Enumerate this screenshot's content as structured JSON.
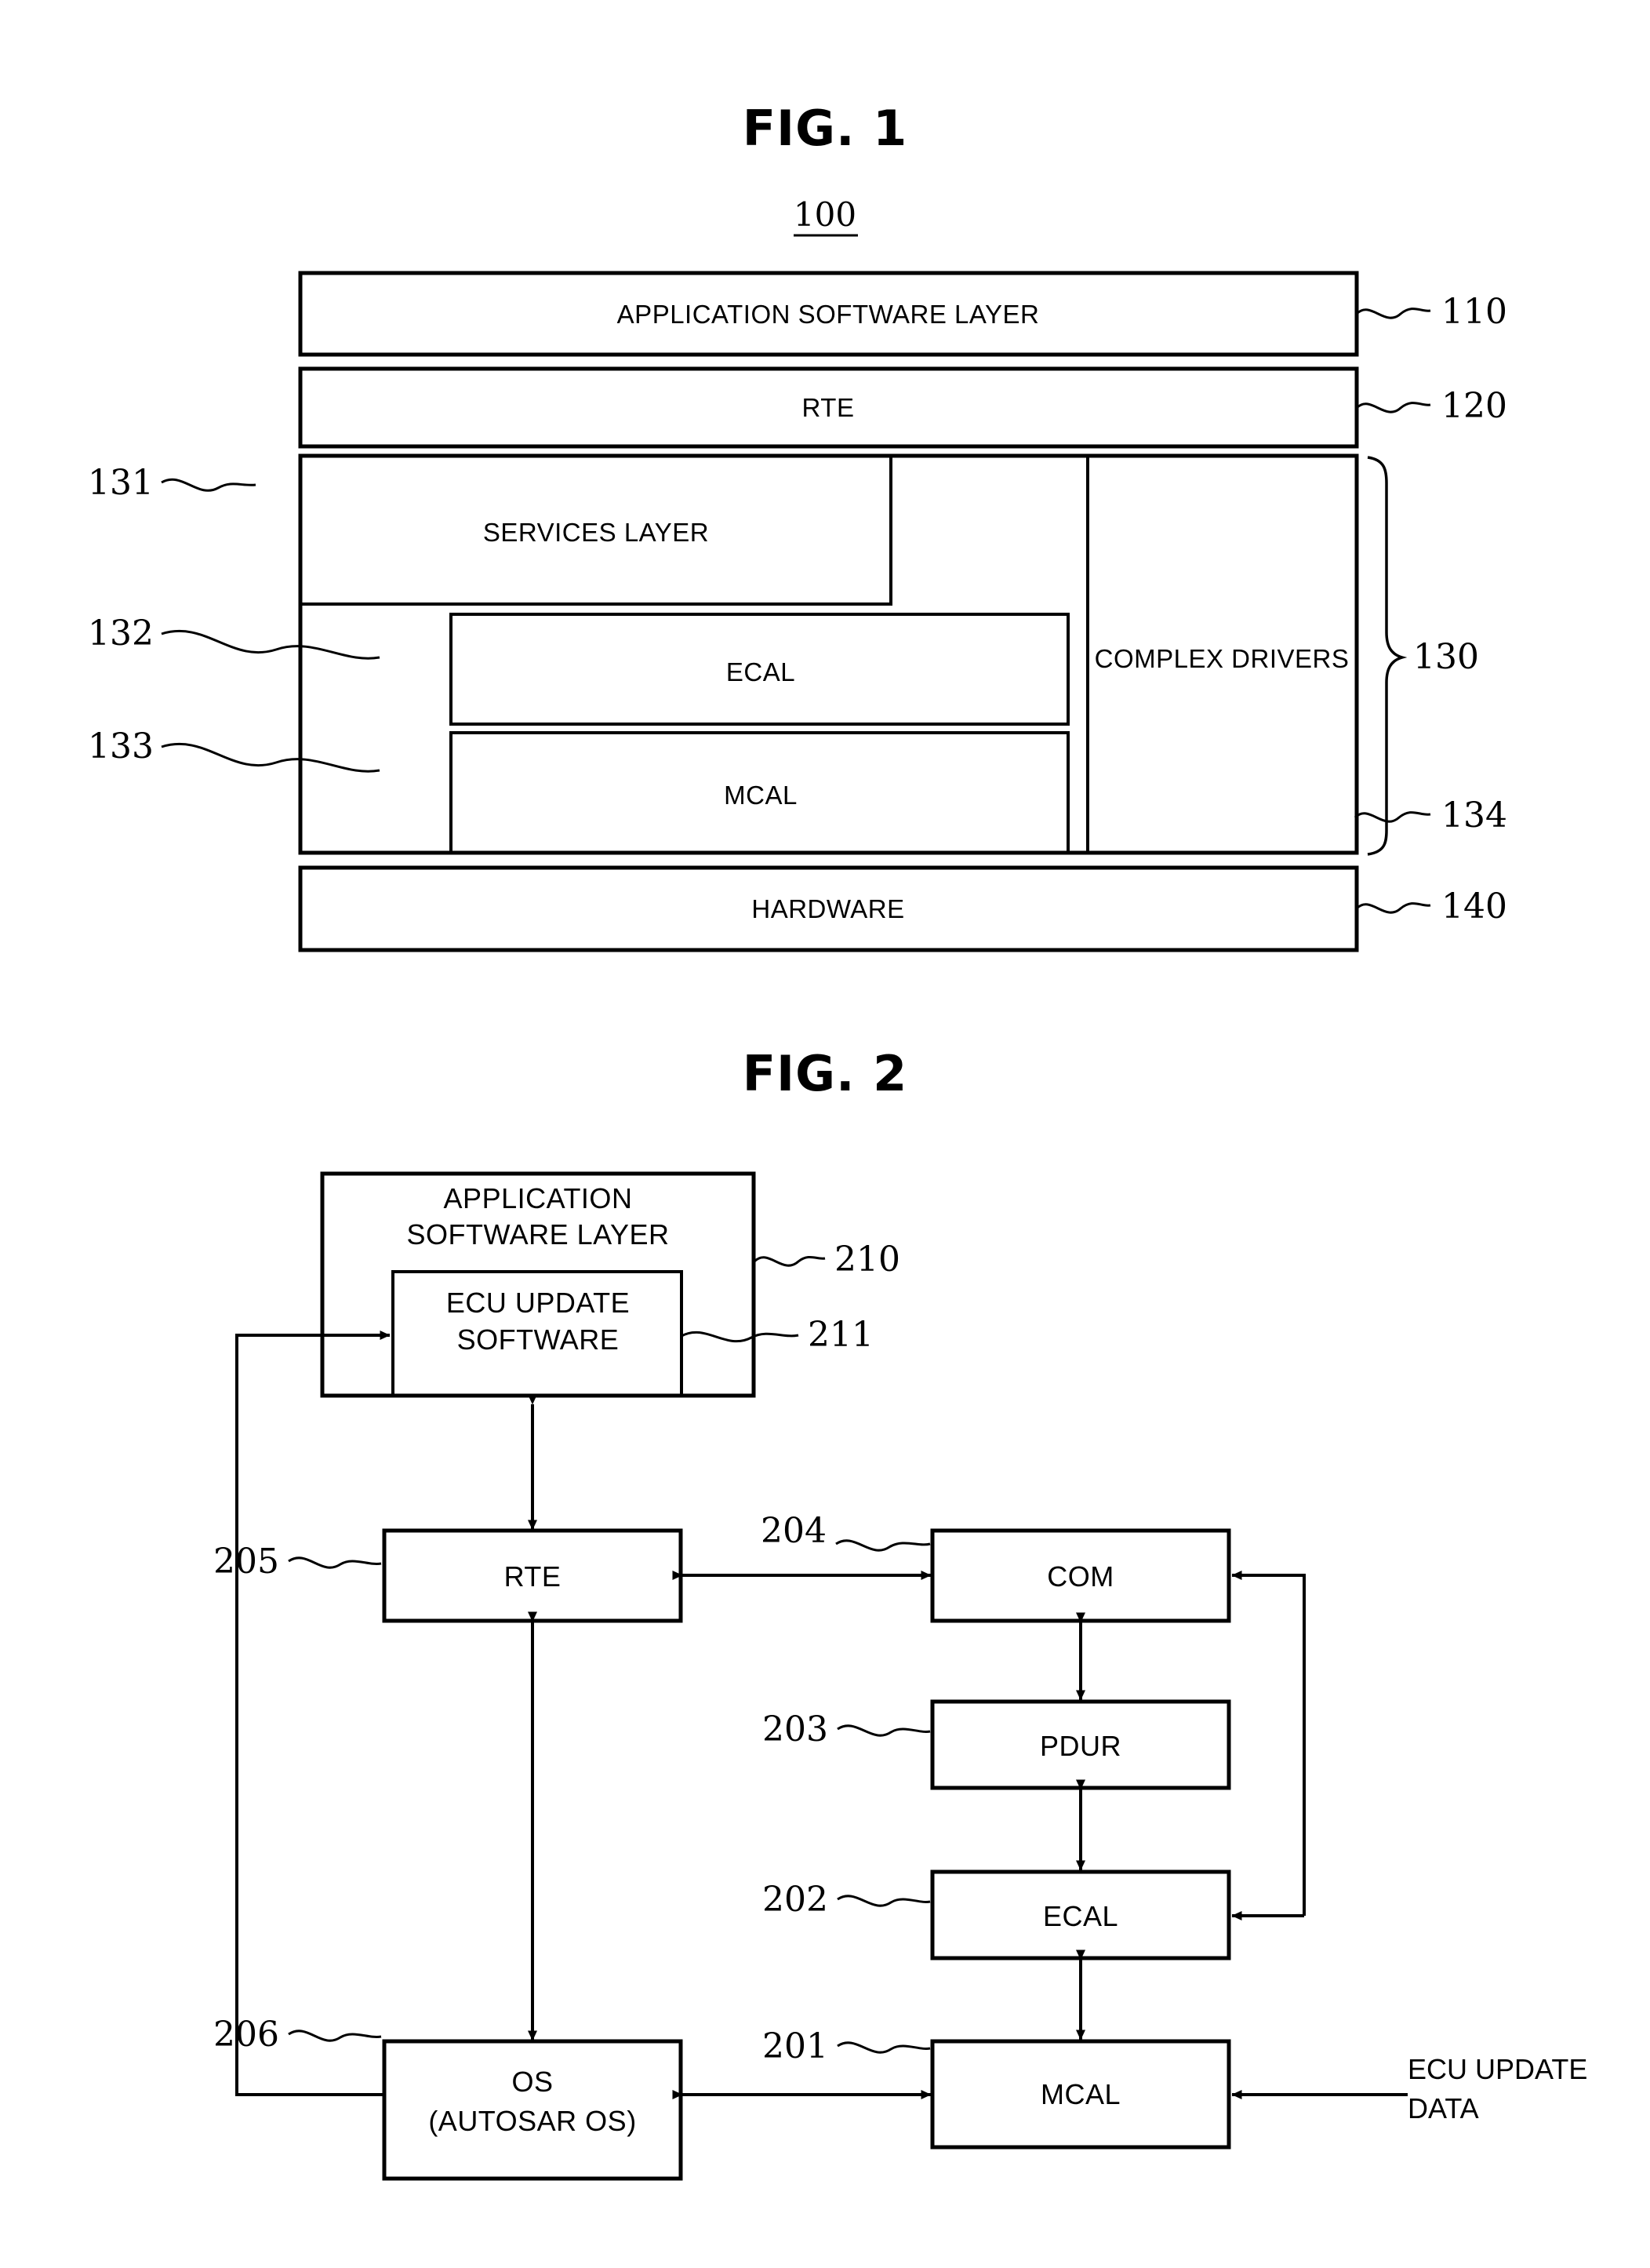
{
  "figures": [
    {
      "id": "fig1",
      "title": "FIG. 1",
      "system_ref": "100",
      "layers": [
        {
          "label": "APPLICATION SOFTWARE LAYER",
          "ref": "110"
        },
        {
          "label": "RTE",
          "ref": "120"
        },
        {
          "label": "SERVICES LAYER",
          "ref": "131"
        },
        {
          "label": "ECAL",
          "ref": "132"
        },
        {
          "label": "MCAL",
          "ref": "133"
        },
        {
          "label": "COMPLEX DRIVERS",
          "ref": "134"
        },
        {
          "label": "HARDWARE",
          "ref": "140"
        }
      ],
      "group_ref": "130"
    },
    {
      "id": "fig2",
      "title": "FIG. 2",
      "blocks": [
        {
          "label": "APPLICATION\nSOFTWARE LAYER",
          "ref": "210"
        },
        {
          "label": "ECU UPDATE\nSOFTWARE",
          "ref": "211"
        },
        {
          "label": "RTE",
          "ref": "205"
        },
        {
          "label": "COM",
          "ref": "204"
        },
        {
          "label": "PDUR",
          "ref": "203"
        },
        {
          "label": "ECAL",
          "ref": "202"
        },
        {
          "label": "OS\n(AUTOSAR OS)",
          "ref": "206"
        },
        {
          "label": "MCAL",
          "ref": "201"
        }
      ],
      "edge_label": "ECU UPDATE\nDATA"
    }
  ],
  "fig1": {
    "title": "FIG. 1",
    "system_ref": "100",
    "app_layer": "APPLICATION SOFTWARE LAYER",
    "app_layer_ref": "110",
    "rte": "RTE",
    "rte_ref": "120",
    "services_layer": "SERVICES LAYER",
    "services_layer_ref": "131",
    "ecal": "ECAL",
    "ecal_ref": "132",
    "mcal": "MCAL",
    "mcal_ref": "133",
    "complex_drivers": "COMPLEX DRIVERS",
    "complex_drivers_ref": "134",
    "bsw_ref": "130",
    "hardware": "HARDWARE",
    "hardware_ref": "140"
  },
  "fig2": {
    "title": "FIG. 2",
    "app_layer_line1": "APPLICATION",
    "app_layer_line2": "SOFTWARE LAYER",
    "app_layer_ref": "210",
    "ecu_update_sw_line1": "ECU UPDATE",
    "ecu_update_sw_line2": "SOFTWARE",
    "ecu_update_sw_ref": "211",
    "rte": "RTE",
    "rte_ref": "205",
    "com": "COM",
    "com_ref": "204",
    "pdur": "PDUR",
    "pdur_ref": "203",
    "ecal": "ECAL",
    "ecal_ref": "202",
    "os_line1": "OS",
    "os_line2": "(AUTOSAR OS)",
    "os_ref": "206",
    "mcal": "MCAL",
    "mcal_ref": "201",
    "ecu_update_data_line1": "ECU UPDATE",
    "ecu_update_data_line2": "DATA"
  },
  "colors": {
    "ink": "#000000",
    "paper": "#ffffff"
  }
}
